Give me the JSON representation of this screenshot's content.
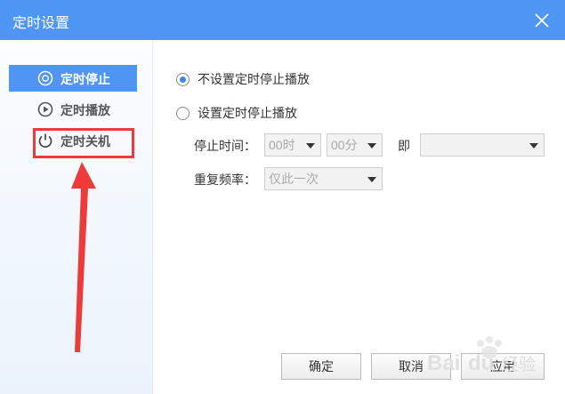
{
  "window": {
    "title": "定时设置"
  },
  "sidebar": {
    "items": [
      {
        "label": "定时停止",
        "icon": "timer-stop-icon",
        "active": true
      },
      {
        "label": "定时播放",
        "icon": "play-circle-icon",
        "active": false
      },
      {
        "label": "定时关机",
        "icon": "power-icon",
        "active": false
      }
    ]
  },
  "options": {
    "no_timer_label": "不设置定时停止播放",
    "set_timer_label": "设置定时停止播放",
    "selected": "no_timer"
  },
  "timer": {
    "stop_time_label": "停止时间：",
    "hour_value": "00时",
    "minute_value": "00分",
    "ji_label": "即",
    "day_value": "",
    "repeat_label": "重复频率：",
    "repeat_value": "仅此一次"
  },
  "buttons": {
    "ok": "确定",
    "cancel": "取消",
    "apply": "应用"
  },
  "colors": {
    "titlebar": "#4f95f3",
    "active_item": "#4f95f3",
    "annotation": "#f03a3a"
  },
  "watermark": {
    "text": "Baidu 经验"
  }
}
